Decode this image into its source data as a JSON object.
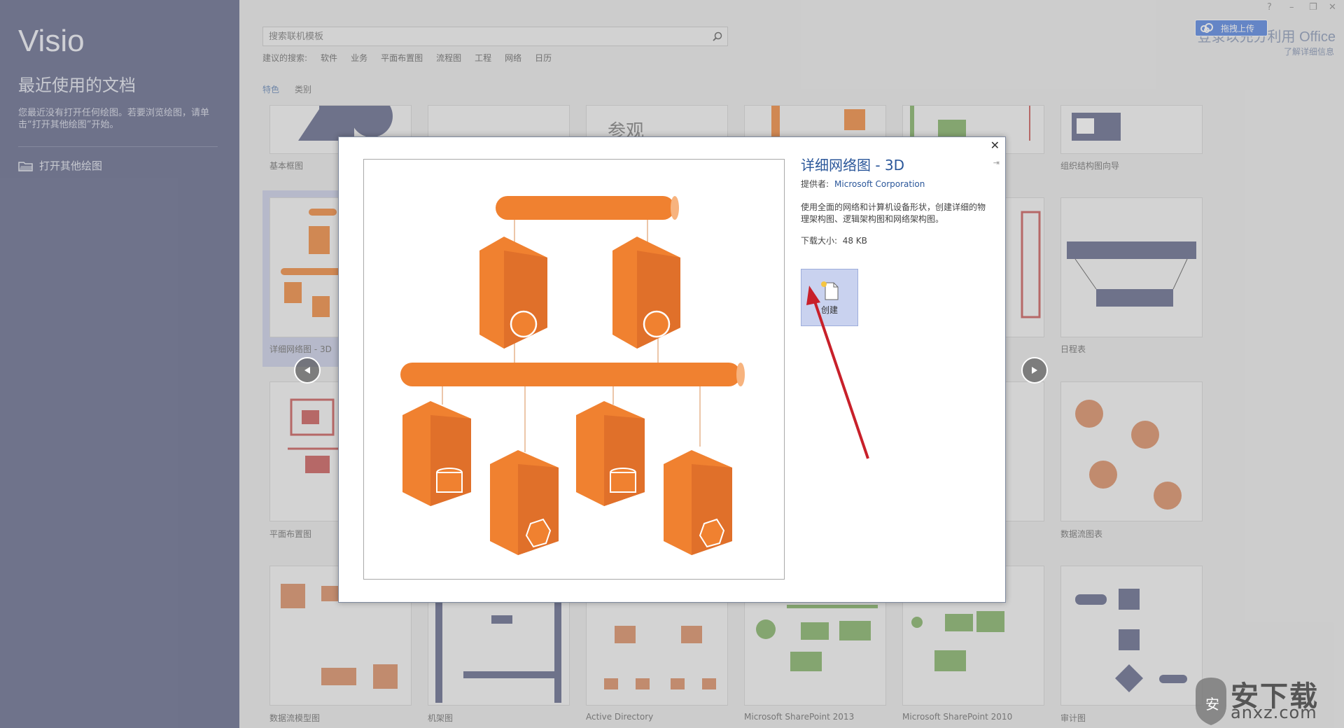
{
  "sidebar": {
    "app_name": "Visio",
    "heading": "最近使用的文档",
    "description": "您最近没有打开任何绘图。若要浏览绘图，请单击“打开其他绘图”开始。",
    "open_other": "打开其他绘图"
  },
  "header": {
    "search_placeholder": "搜索联机模板",
    "suggested_label": "建议的搜索:",
    "suggested": [
      "软件",
      "业务",
      "平面布置图",
      "流程图",
      "工程",
      "网络",
      "日历"
    ],
    "tabs": [
      "特色",
      "类别"
    ],
    "signin_text": "登录以充分利用 Office",
    "learn_more": "了解详细信息",
    "upload_label": "拖拽上传",
    "window_controls": [
      "?",
      "–",
      "❐",
      "✕"
    ]
  },
  "tiles": {
    "basic_diagram": "基本框图",
    "reference": "参观",
    "org_wizard": "组织结构图向导",
    "network_3d": "详细网络图 - 3D",
    "timeline": "日程表",
    "floor_plan": "平面布置图",
    "dataflow": "数据流图表",
    "dfd": "数据流模型图",
    "rack": "机架图",
    "active_directory": "Active Directory",
    "sp2013": "Microsoft SharePoint 2013",
    "sp2010": "Microsoft SharePoint 2010",
    "audit": "审计图"
  },
  "modal": {
    "title": "详细网络图 - 3D",
    "provider_label": "提供者:",
    "provider": "Microsoft Corporation",
    "description": "使用全面的网络和计算机设备形状，创建详细的物理架构图、逻辑架构图和网络架构图。",
    "size_label": "下载大小:",
    "size_value": "48 KB",
    "create_label": "创建",
    "close": "✕",
    "pin": "⇥"
  },
  "watermark": {
    "text": "安下载",
    "url": "anxz.com"
  },
  "colors": {
    "sidebar": "#5a6085",
    "accent": "#2b579a",
    "orange": "#f08130",
    "red_arrow": "#c8202a"
  }
}
